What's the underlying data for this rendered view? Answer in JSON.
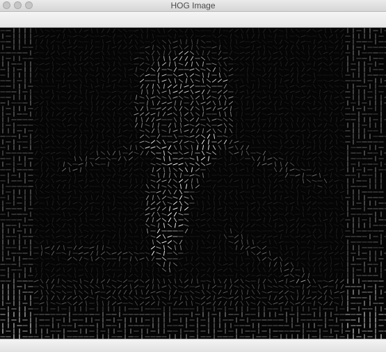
{
  "window": {
    "title": "HOG Image"
  },
  "image": {
    "name": "hog-visualization",
    "background_color": "#050505",
    "stroke_color": "#ffffff"
  }
}
